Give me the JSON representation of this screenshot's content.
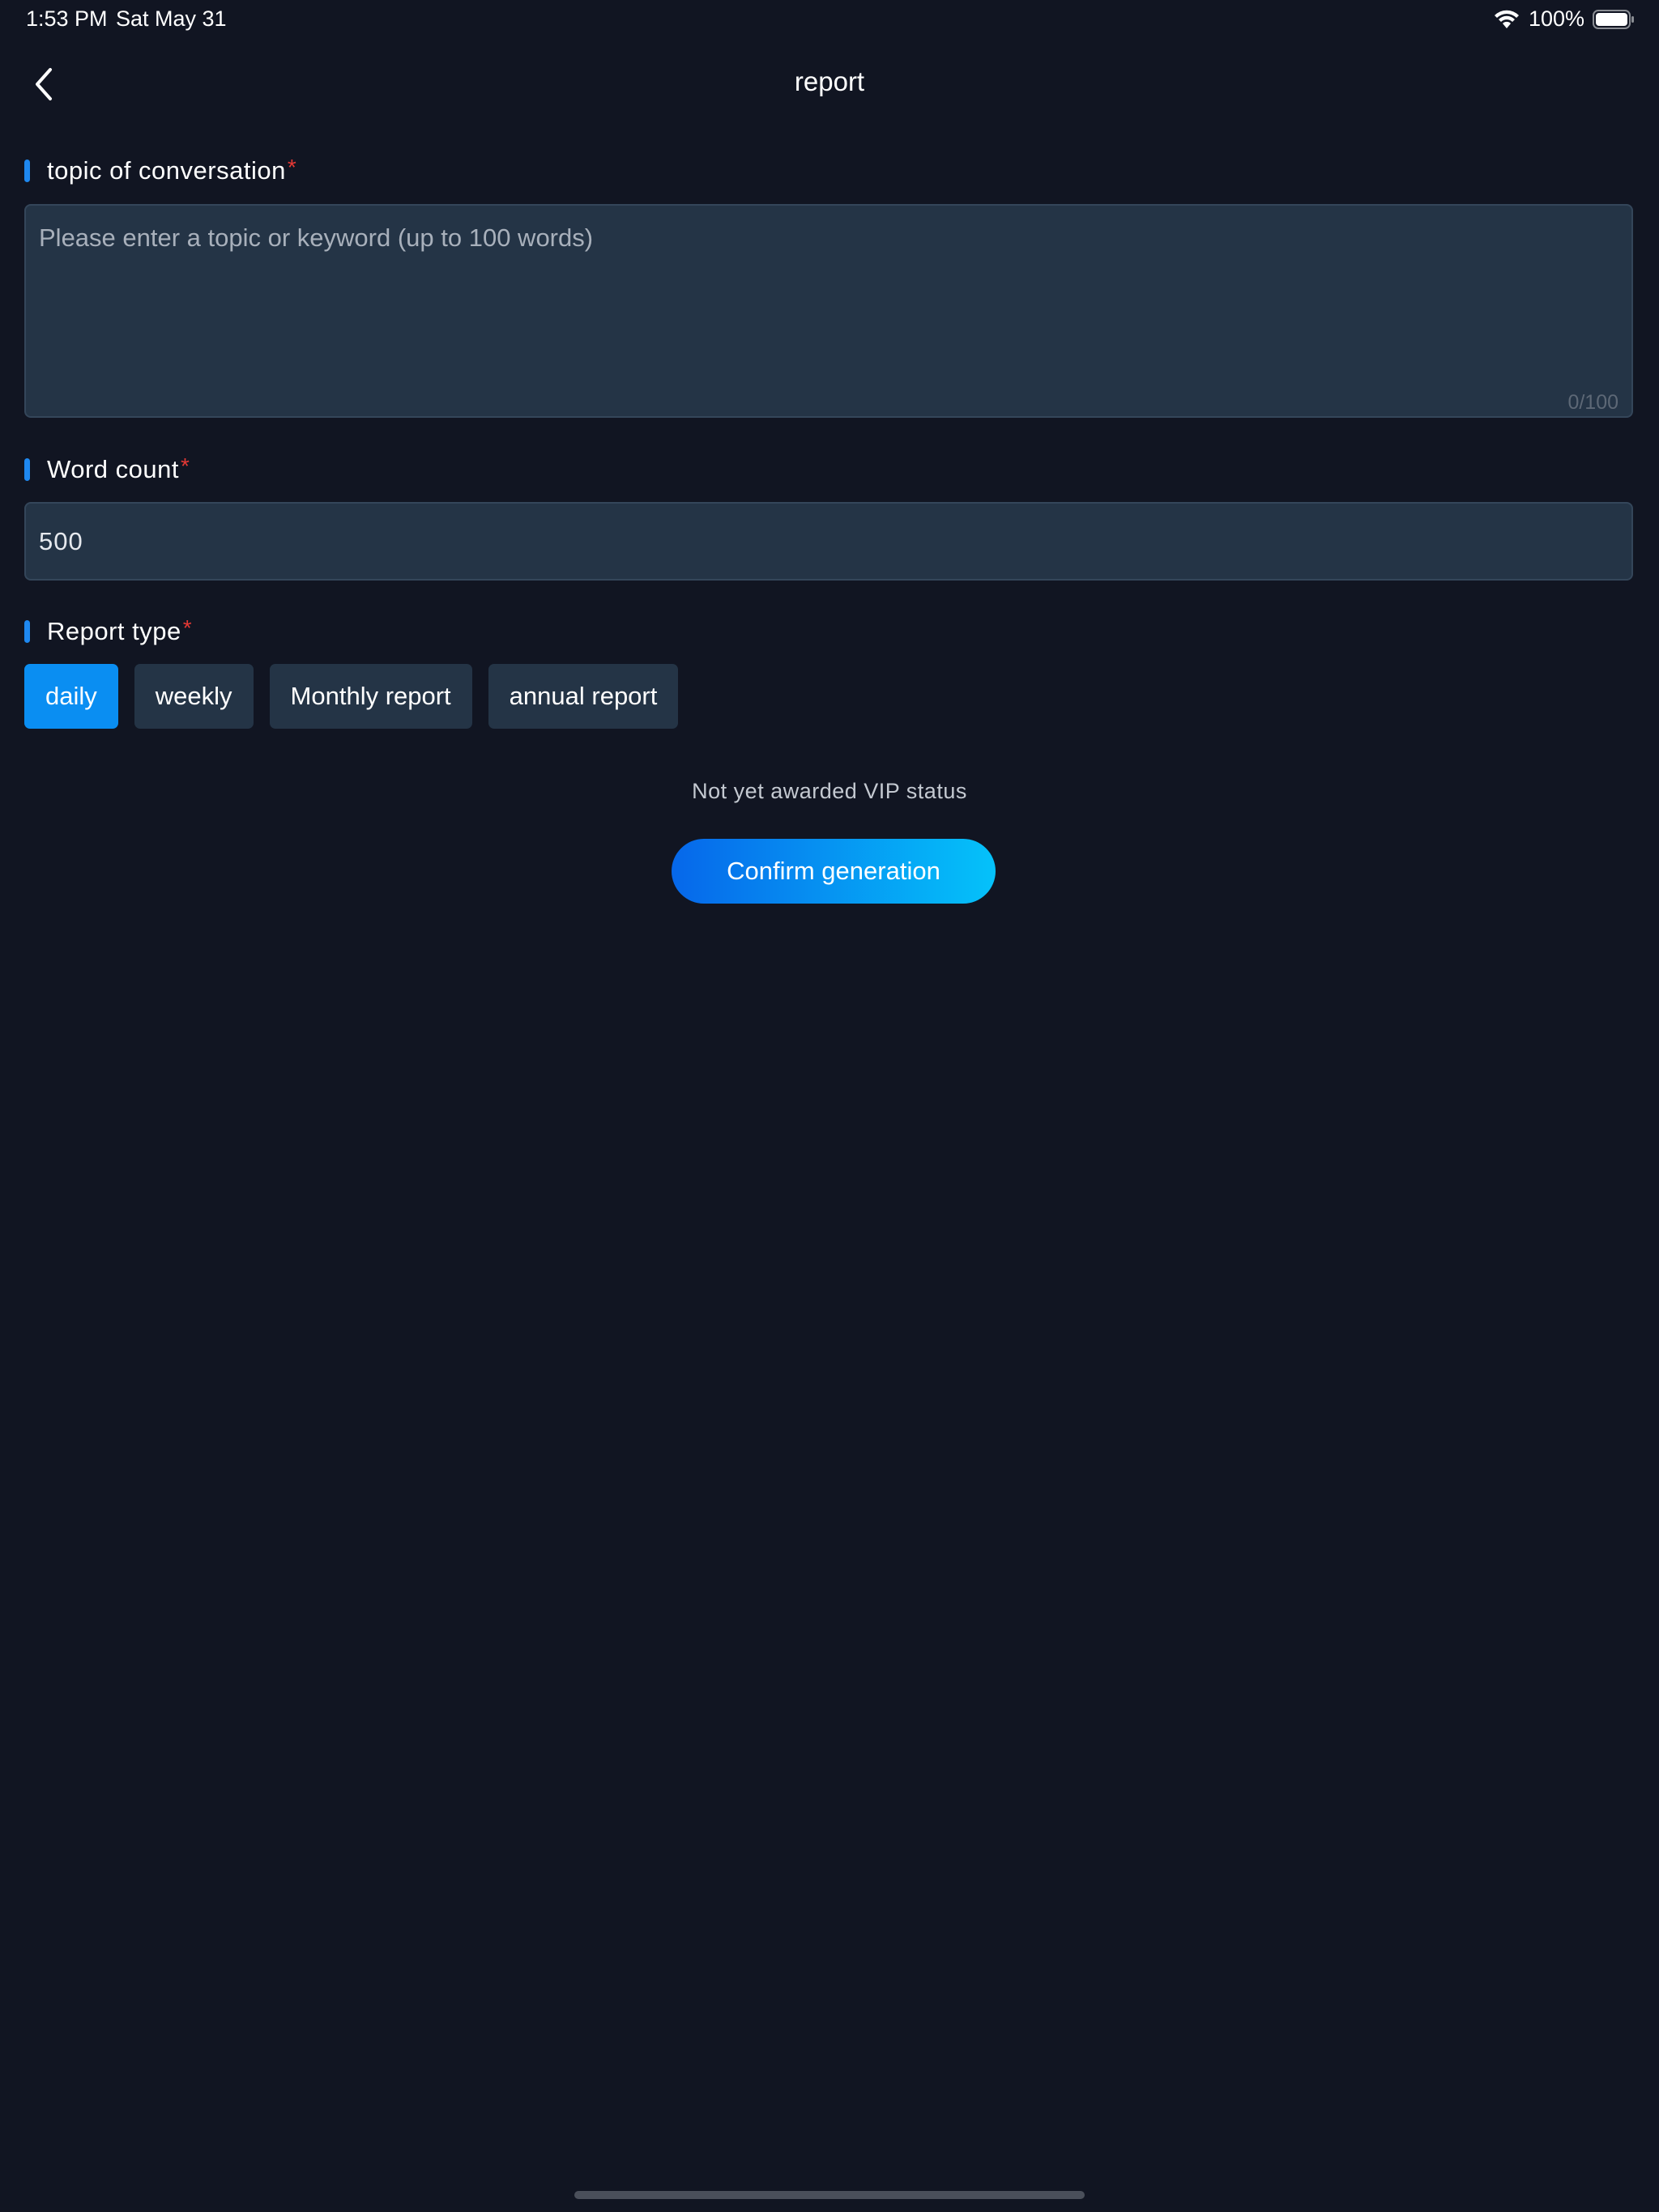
{
  "status_bar": {
    "time": "1:53 PM",
    "date": "Sat May 31",
    "battery_percent": "100%",
    "wifi_icon": "wifi-icon",
    "battery_icon": "battery-icon"
  },
  "nav": {
    "title": "report",
    "back_icon": "chevron-left-icon"
  },
  "topic": {
    "label": "topic of conversation",
    "required_mark": "*",
    "value": "",
    "placeholder": "Please enter a topic or keyword (up to 100 words)",
    "counter": "0/100"
  },
  "word_count": {
    "label": "Word count",
    "required_mark": "*",
    "value": "500"
  },
  "report_type": {
    "label": "Report type",
    "required_mark": "*",
    "options": [
      {
        "label": "daily",
        "selected": true
      },
      {
        "label": "weekly",
        "selected": false
      },
      {
        "label": "Monthly report",
        "selected": false
      },
      {
        "label": "annual report",
        "selected": false
      }
    ]
  },
  "vip_status_text": "Not yet awarded VIP status",
  "confirm_button_label": "Confirm generation",
  "colors": {
    "background": "#111522",
    "field_background": "#243446",
    "accent": "#0a8ef2",
    "label_bar": "#1e88f0",
    "required": "#e53935",
    "button_gradient_start": "#0667ea",
    "button_gradient_end": "#05c2fa"
  }
}
